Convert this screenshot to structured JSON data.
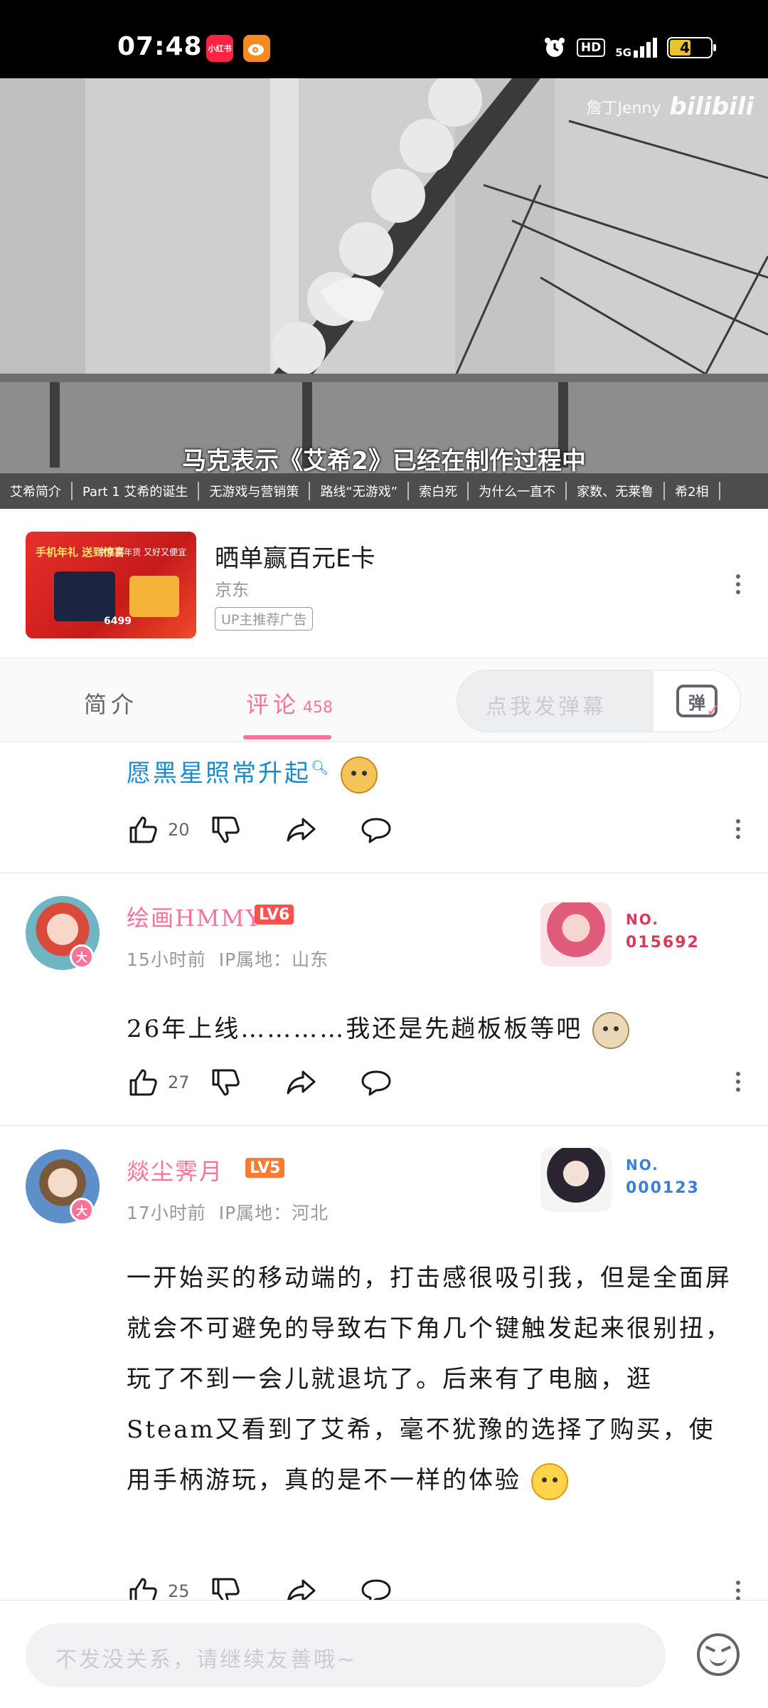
{
  "status_bar": {
    "time": "07:48",
    "apps": [
      "小红书",
      "微博"
    ],
    "network": "HD",
    "signal_label": "5G",
    "battery": "48"
  },
  "video": {
    "watermark_author": "詹丁Jenny",
    "watermark_brand": "bilibili",
    "subtitle": "马克表示《艾希2》已经在制作过程中",
    "chapters": [
      "艾希简介",
      "Part 1 艾希的诞生",
      "无游戏与营销策",
      "路线“无游戏”",
      "索白死",
      "为什么一直不",
      "家数、无莱鲁",
      "希2相"
    ]
  },
  "ad": {
    "title": "晒单赢百元E卡",
    "source": "京东",
    "tag": "UP主推荐广告",
    "image_text_1": "手机年礼 送到惊喜",
    "image_text_2": "京东买年货 又好又便宜",
    "image_price": "6499"
  },
  "tabs": {
    "intro": "简介",
    "comments": "评论",
    "comment_count": "458",
    "danmaku_placeholder": "点我发弹幕",
    "danmaku_icon": "弹"
  },
  "comments": [
    {
      "text": "愿黑星照常升起",
      "likes": "20"
    },
    {
      "username": "绘画HMMY",
      "level": "LV6",
      "badge": "大",
      "time": "15小时前",
      "ip": "IP属地：山东",
      "fan_label": "NO.",
      "fan_number": "015692",
      "fan_color": "#d63b5a",
      "text": "26年上线…………我还是先趟板板等吧",
      "likes": "27"
    },
    {
      "username": "燚尘霁月",
      "level": "LV5",
      "badge": "大",
      "time": "17小时前",
      "ip": "IP属地：河北",
      "fan_label": "NO.",
      "fan_number": "000123",
      "fan_color": "#3b7fd6",
      "text": "一开始买的移动端的，打击感很吸引我，但是全面屏就会不可避免的导致右下角几个键触发起来很别扭，玩了不到一会儿就退坑了。后来有了电脑，逛Steam又看到了艾希，毫不犹豫的选择了购买，使用手柄游玩，真的是不一样的体验",
      "likes": "25"
    }
  ],
  "bottom": {
    "placeholder": "不发没关系，请继续友善哦~"
  },
  "colors": {
    "accent": "#fb7299",
    "text": "#18191c",
    "secondary": "#9499a0",
    "link_blue": "#178bcf"
  }
}
